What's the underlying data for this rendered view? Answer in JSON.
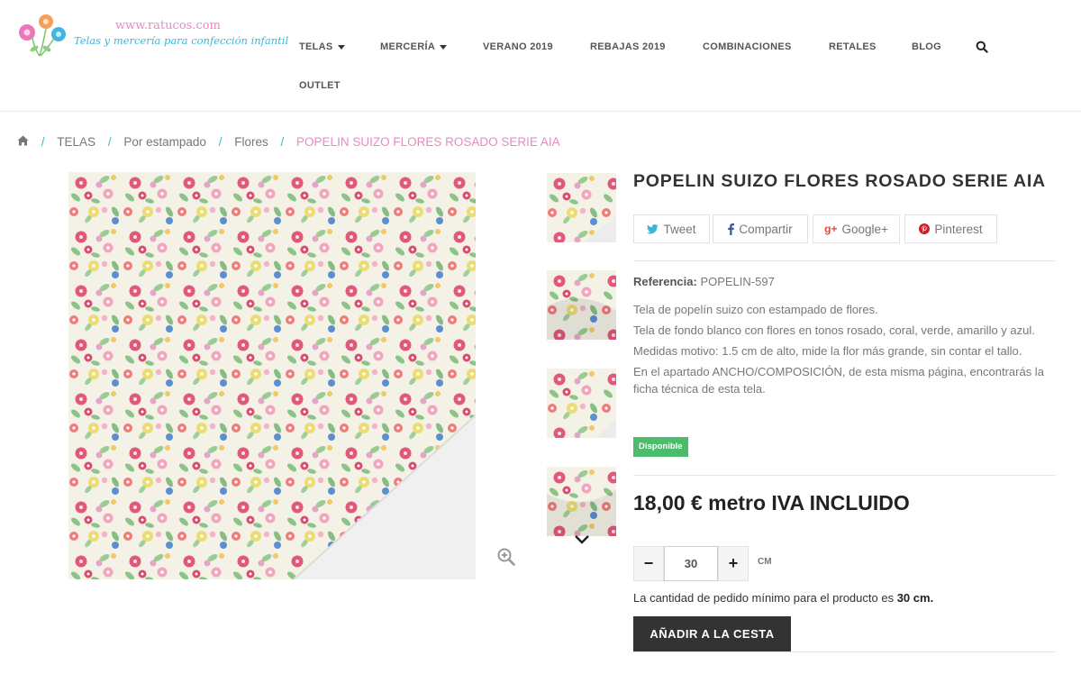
{
  "logo": {
    "url_text": "www.ratucos.com",
    "tagline": "Telas y mercería para confección infantil"
  },
  "nav": {
    "items": [
      {
        "label": "TELAS",
        "dropdown": true
      },
      {
        "label": "MERCERÍA",
        "dropdown": true
      },
      {
        "label": "VERANO 2019",
        "dropdown": false
      },
      {
        "label": "REBAJAS 2019",
        "dropdown": false
      },
      {
        "label": "COMBINACIONES",
        "dropdown": false
      },
      {
        "label": "RETALES",
        "dropdown": false
      },
      {
        "label": "BLOG",
        "dropdown": false
      },
      {
        "label": "OUTLET",
        "dropdown": false
      }
    ],
    "search_icon": "search-icon"
  },
  "breadcrumb": {
    "home_icon": "home-icon",
    "items": [
      "TELAS",
      "Por estampado",
      "Flores"
    ],
    "current": "POPELIN SUIZO FLORES ROSADO SERIE AIA"
  },
  "product": {
    "title": "POPELIN SUIZO FLORES ROSADO SERIE AIA",
    "share": {
      "tweet": "Tweet",
      "facebook": "Compartir",
      "google": "Google+",
      "pinterest": "Pinterest"
    },
    "reference_label": "Referencia:",
    "reference_value": "POPELIN-597",
    "description": [
      "Tela de popelín suizo con estampado de flores.",
      "Tela de fondo blanco con flores en tonos rosado, coral, verde, amarillo y azul.",
      "Medidas motivo: 1.5 cm de alto, mide la flor más grande, sin contar el tallo.",
      "En el apartado ANCHO/COMPOSICIÓN, de esta misma página, encontrarás la ficha técnica de esta tela."
    ],
    "availability": "Disponible",
    "price": "18,00 € metro IVA INCLUIDO",
    "quantity": {
      "minus": "−",
      "value": "30",
      "plus": "+",
      "unit": "CM"
    },
    "min_note_prefix": "La cantidad de pedido mínimo para el producto es ",
    "min_note_value": "30 cm.",
    "add_to_cart": "AÑADIR A LA CESTA"
  },
  "colors": {
    "accent_pink": "#e78ac3",
    "accent_blue": "#3cb5d8",
    "available_green": "#4cbb6c",
    "button_dark": "#333333"
  }
}
